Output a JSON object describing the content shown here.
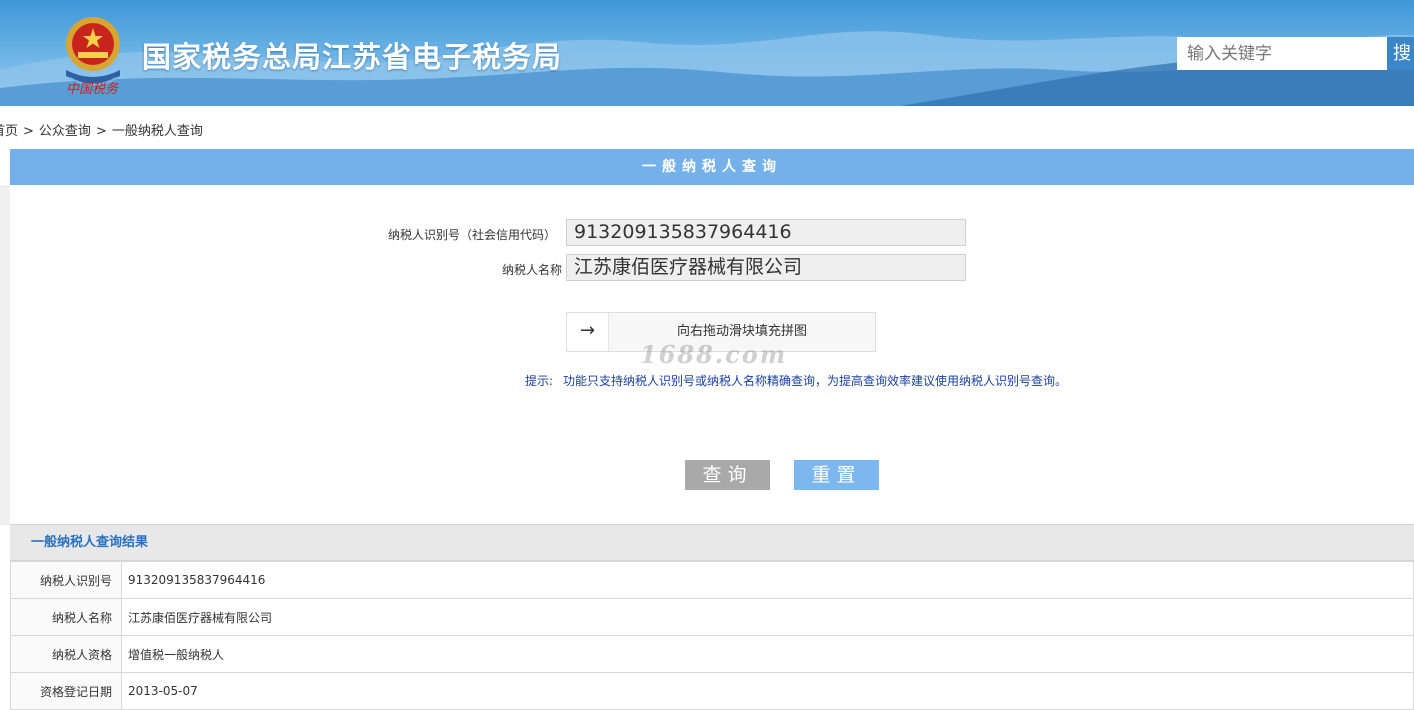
{
  "header": {
    "site_title": "国家税务总局江苏省电子税务局",
    "emblem_caption": "中国税务",
    "search_placeholder": "输入关键字",
    "search_button": "搜"
  },
  "breadcrumb": {
    "items": [
      "首页",
      "公众查询",
      "一般纳税人查询"
    ],
    "separator": ">"
  },
  "query_panel": {
    "title": "一般纳税人查询",
    "fields": [
      {
        "label": "纳税人识别号（社会信用代码）",
        "value": "913209135837964416"
      },
      {
        "label": "纳税人名称",
        "value": "江苏康佰医疗器械有限公司"
      }
    ],
    "slider": {
      "arrow": "→",
      "text": "向右拖动滑块填充拼图"
    },
    "watermark": "1688.com",
    "hint_label": "提示:",
    "hint_text": "功能只支持纳税人识别号或纳税人名称精确查询，为提高查询效率建议使用纳税人识别号查询。",
    "query_button": "查询",
    "reset_button": "重置"
  },
  "result": {
    "title": "一般纳税人查询结果",
    "rows": [
      {
        "key": "纳税人识别号",
        "value": "913209135837964416"
      },
      {
        "key": "纳税人名称",
        "value": "江苏康佰医疗器械有限公司"
      },
      {
        "key": "纳税人资格",
        "value": "增值税一般纳税人"
      },
      {
        "key": "资格登记日期",
        "value": "2013-05-07"
      }
    ]
  },
  "colors": {
    "banner": "#3f97d9",
    "panel_header": "#74b1ea",
    "query_button": "#a9a9a9",
    "reset_button": "#7cb8ee",
    "result_title": "#2a72bf",
    "hint": "#1a3fa0"
  }
}
